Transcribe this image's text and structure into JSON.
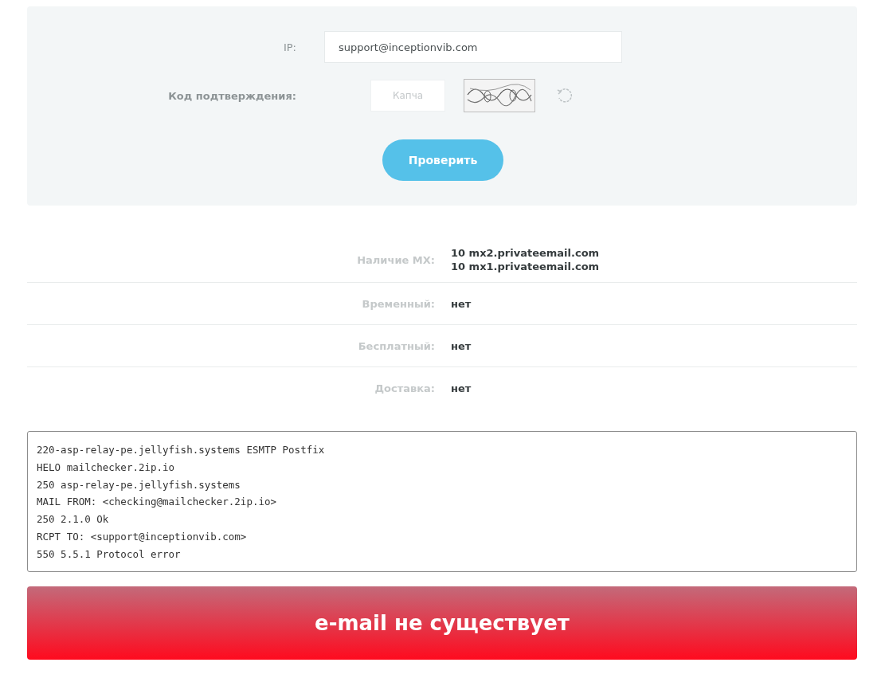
{
  "form": {
    "ip_label": "IP:",
    "ip_value": "support@inceptionvib.com",
    "captcha_label": "Код подтверждения:",
    "captcha_placeholder": "Капча",
    "submit": "Проверить"
  },
  "results": [
    {
      "label": "Наличие MX:",
      "values": [
        "**10** mx2.privateemail.com",
        "**10** mx1.privateemail.com"
      ]
    },
    {
      "label": "Временный:",
      "values": [
        "нет"
      ]
    },
    {
      "label": "Бесплатный:",
      "values": [
        "нет"
      ]
    },
    {
      "label": "Доставка:",
      "values": [
        "нет"
      ]
    }
  ],
  "log": [
    "220-asp-relay-pe.jellyfish.systems ESMTP Postfix",
    "HELO mailchecker.2ip.io",
    "250 asp-relay-pe.jellyfish.systems",
    "MAIL FROM: <checking@mailchecker.2ip.io>",
    "250 2.1.0 Ok",
    "RCPT TO: <support@inceptionvib.com>",
    "550 5.5.1 Protocol error"
  ],
  "verdict": {
    "text": "e-mail не существует",
    "failed": true
  }
}
